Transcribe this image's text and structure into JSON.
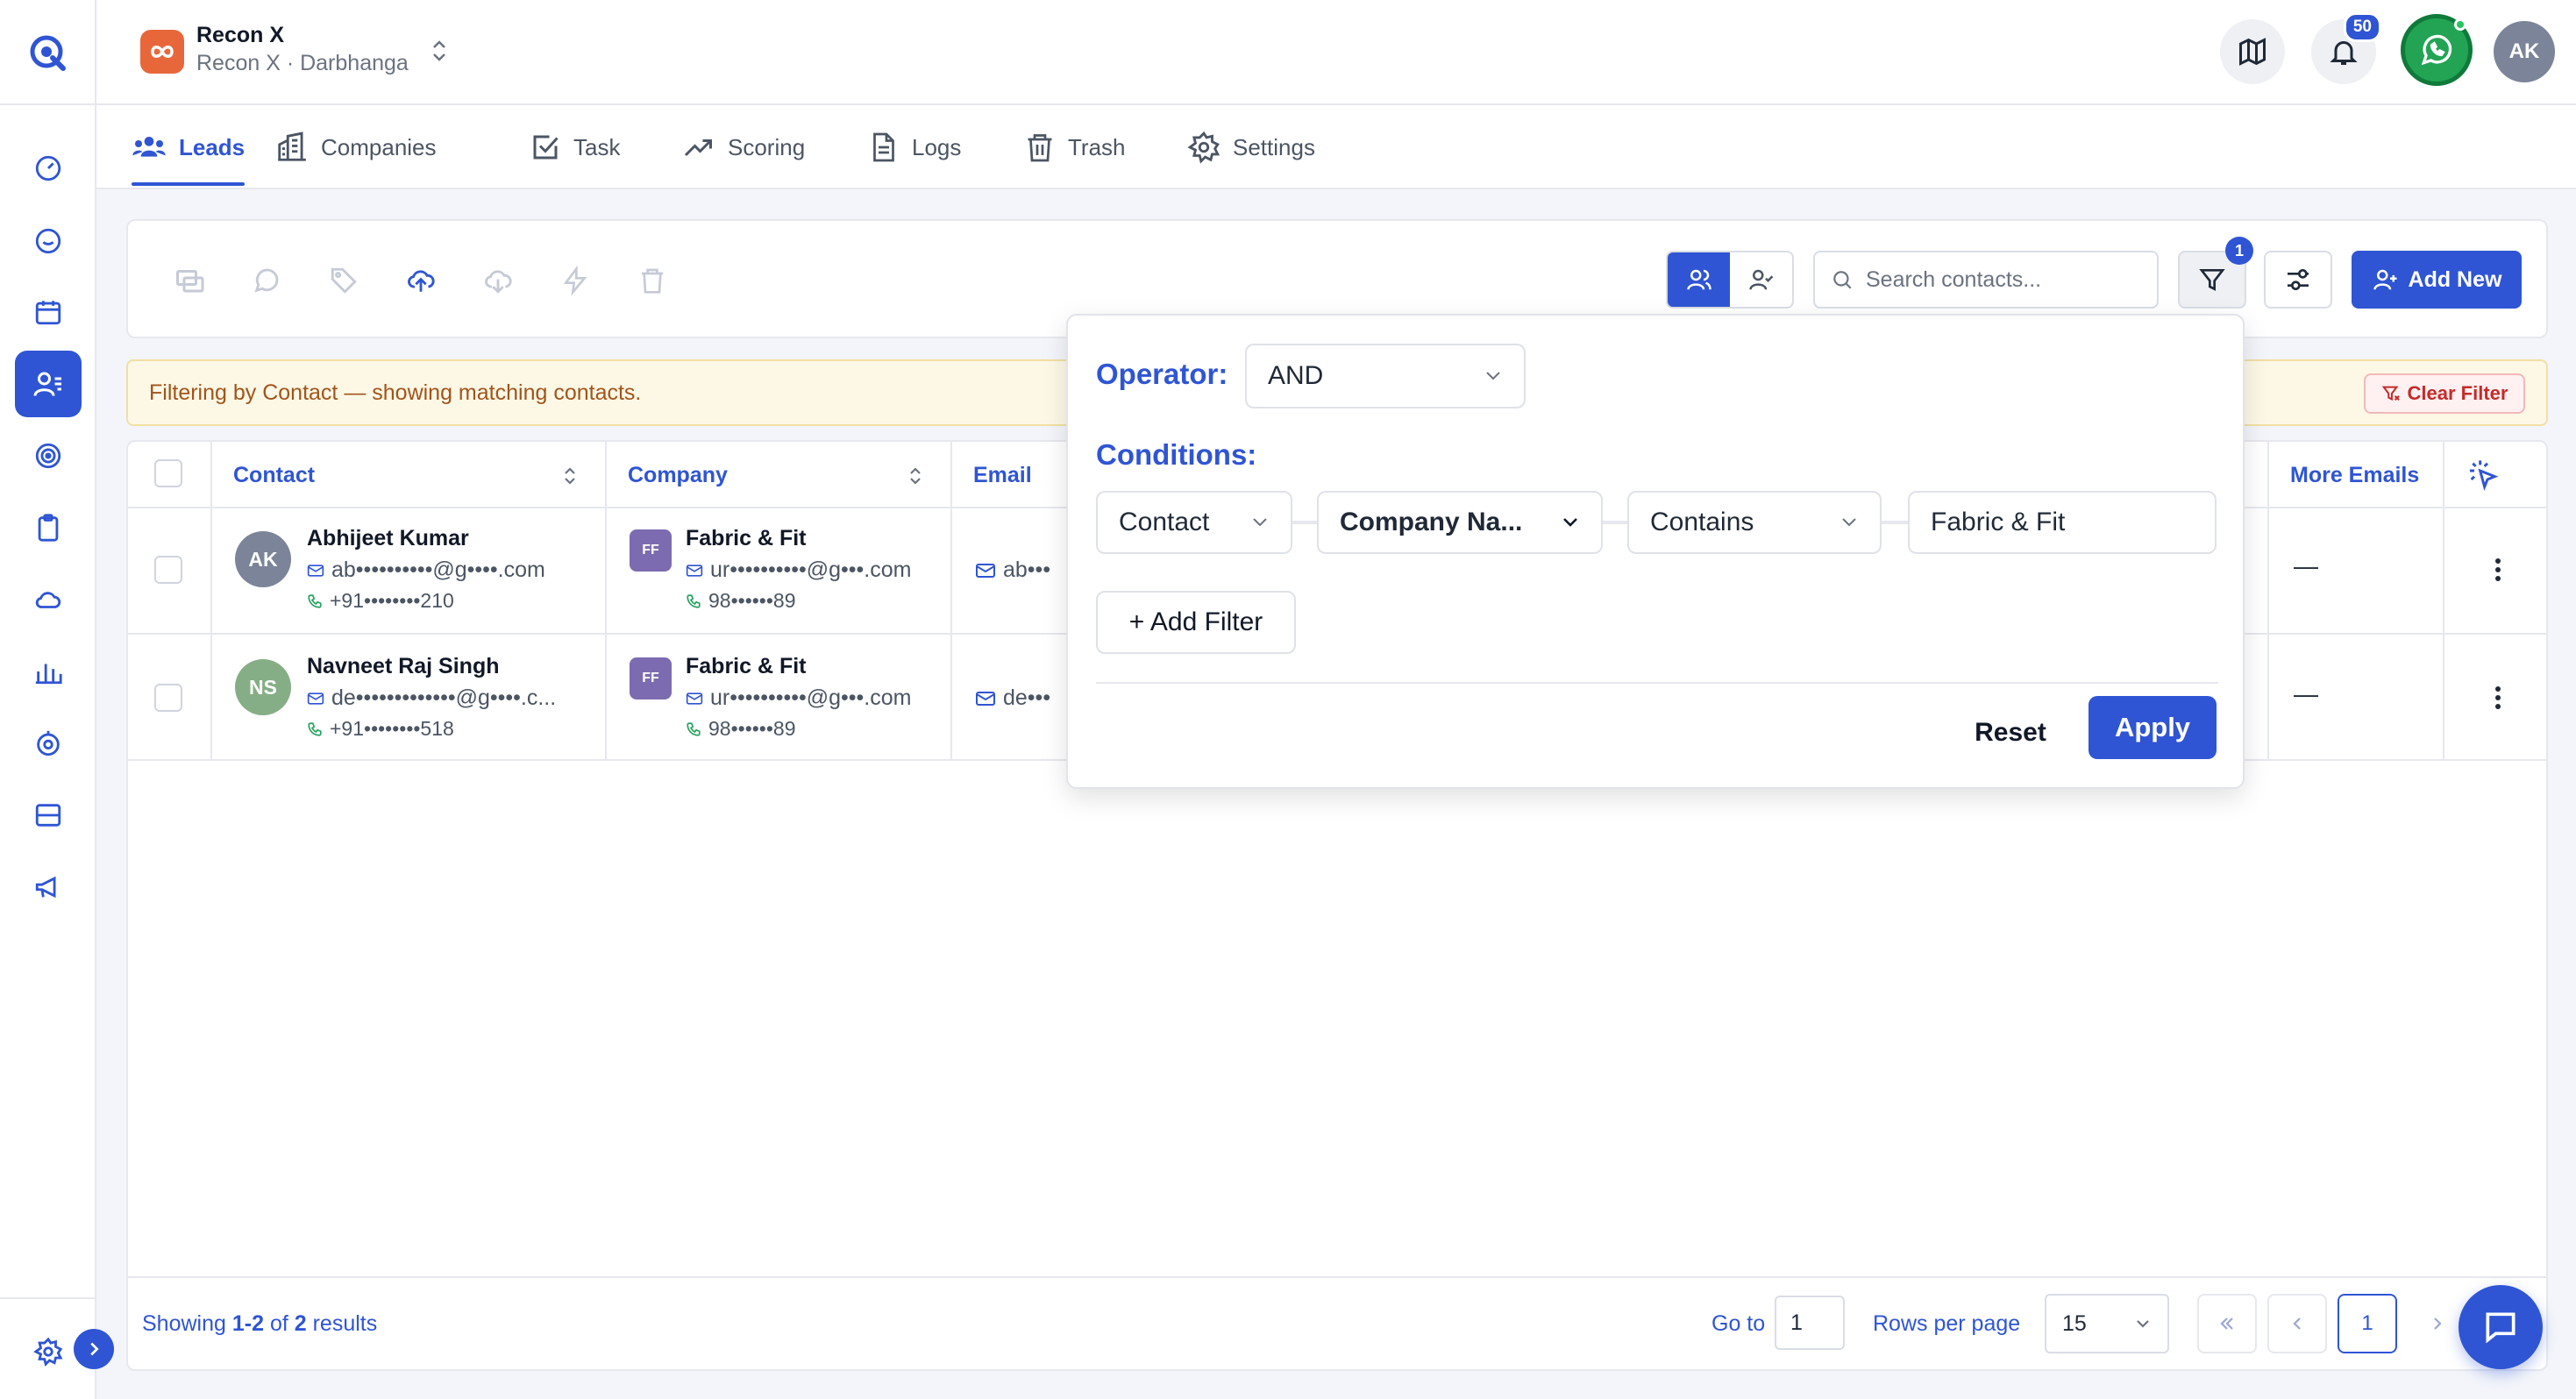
{
  "workspace": {
    "name": "Recon X",
    "subtitle": "Recon X · Darbhanga",
    "initials": "AK",
    "notifications": "50"
  },
  "nav_tabs": [
    "Leads",
    "Companies",
    "Task",
    "Scoring",
    "Logs",
    "Trash",
    "Settings"
  ],
  "search": {
    "placeholder": "Search contacts..."
  },
  "filter_count": "1",
  "add_new_label": "Add New",
  "banner": {
    "text": "Filtering by Contact — showing matching contacts.",
    "clear_label": "Clear Filter"
  },
  "table": {
    "headers": {
      "contact": "Contact",
      "company": "Company",
      "email": "Email",
      "more_emails": "More Emails"
    },
    "rows": [
      {
        "initials": "AK",
        "name": "Abhijeet Kumar",
        "email": "ab••••••••••@g••••.com",
        "phone": "+91••••••••210",
        "company_initials": "FF",
        "company": "Fabric & Fit",
        "company_email": "ur••••••••••@g•••.com",
        "company_phone": "98••••••89",
        "email_col": "ab•••",
        "more_emails": "—"
      },
      {
        "initials": "NS",
        "name": "Navneet Raj Singh",
        "email": "de•••••••••••••@g••••.c...",
        "phone": "+91••••••••518",
        "company_initials": "FF",
        "company": "Fabric & Fit",
        "company_email": "ur••••••••••@g•••.com",
        "company_phone": "98••••••89",
        "email_col": "de•••",
        "more_emails": "—"
      }
    ]
  },
  "footer": {
    "showing_prefix": "Showing ",
    "showing_range": "1-2",
    "showing_of": " of ",
    "showing_total": "2",
    "showing_suffix": " results",
    "goto_label": "Go to",
    "goto_value": "1",
    "rows_per_page_label": "Rows per page",
    "rows_per_page_value": "15",
    "current_page": "1"
  },
  "filter_panel": {
    "operator_label": "Operator:",
    "operator_value": "AND",
    "conditions_label": "Conditions:",
    "condition": {
      "entity": "Contact",
      "field": "Company Na...",
      "comparator": "Contains",
      "value": "Fabric & Fit"
    },
    "add_filter_label": "+ Add Filter",
    "reset_label": "Reset",
    "apply_label": "Apply"
  },
  "colors": {
    "accent": "#2f55d4",
    "banner_bg": "#fdf8e6",
    "whatsapp": "#23a455",
    "workspace_badge": "#e8673a"
  }
}
